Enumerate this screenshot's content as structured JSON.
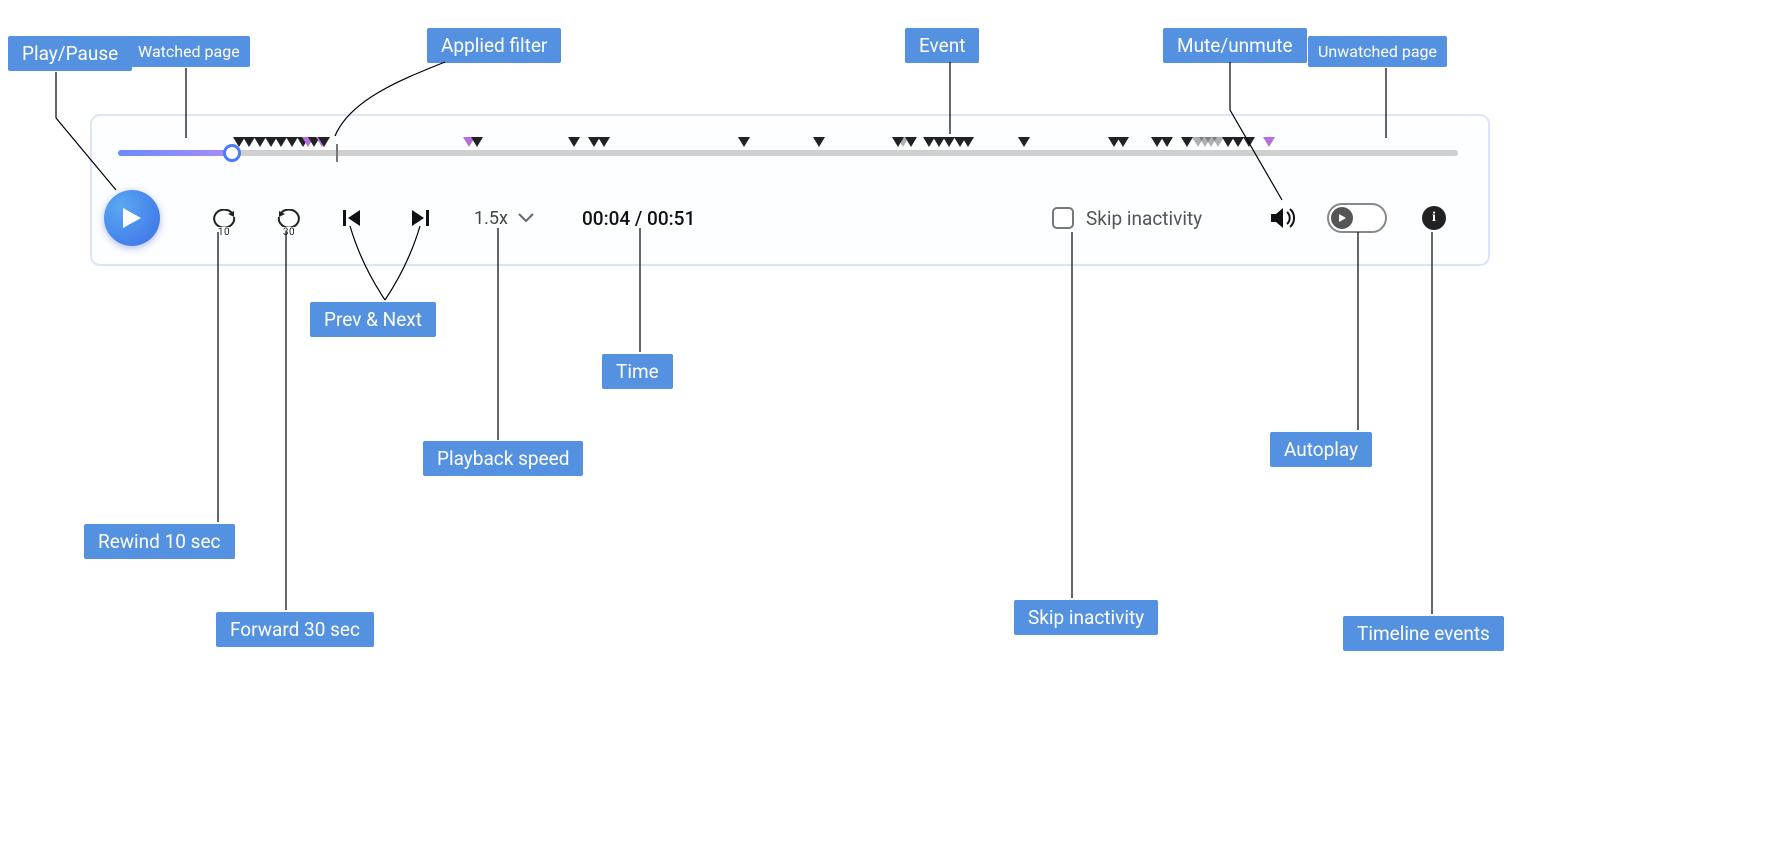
{
  "callouts": {
    "play_pause": "Play/Pause",
    "watched_page": "Watched page",
    "applied_filter": "Applied filter",
    "event": "Event",
    "mute_unmute": "Mute/unmute",
    "unwatched_page": "Unwatched page",
    "prev_next": "Prev & Next",
    "time": "Time",
    "playback_speed": "Playback speed",
    "rewind_10": "Rewind 10 sec",
    "forward_30": "Forward 30 sec",
    "skip_inactivity": "Skip inactivity",
    "autoplay": "Autoplay",
    "timeline_events": "Timeline events"
  },
  "player": {
    "rewind_amount": "10",
    "forward_amount": "30",
    "speed": "1.5x",
    "time": "00:04 / 00:51",
    "skip_label": "Skip inactivity",
    "progress_pct": 8.5,
    "filter_pct": 16.3
  },
  "markers": [
    {
      "p": 9.0,
      "t": "n"
    },
    {
      "p": 9.8,
      "t": "n"
    },
    {
      "p": 10.6,
      "t": "n"
    },
    {
      "p": 11.4,
      "t": "n"
    },
    {
      "p": 12.2,
      "t": "n"
    },
    {
      "p": 13.0,
      "t": "n"
    },
    {
      "p": 13.8,
      "t": "n"
    },
    {
      "p": 14.2,
      "t": "a"
    },
    {
      "p": 14.6,
      "t": "n"
    },
    {
      "p": 15.2,
      "t": "a"
    },
    {
      "p": 15.4,
      "t": "n"
    },
    {
      "p": 26.2,
      "t": "a"
    },
    {
      "p": 26.8,
      "t": "n"
    },
    {
      "p": 34.0,
      "t": "n"
    },
    {
      "p": 35.5,
      "t": "n"
    },
    {
      "p": 36.3,
      "t": "n"
    },
    {
      "p": 46.7,
      "t": "n"
    },
    {
      "p": 52.3,
      "t": "n"
    },
    {
      "p": 58.2,
      "t": "n"
    },
    {
      "p": 58.6,
      "t": "f"
    },
    {
      "p": 59.2,
      "t": "n"
    },
    {
      "p": 60.5,
      "t": "n"
    },
    {
      "p": 61.3,
      "t": "n"
    },
    {
      "p": 62.0,
      "t": "n"
    },
    {
      "p": 62.8,
      "t": "n"
    },
    {
      "p": 63.4,
      "t": "n"
    },
    {
      "p": 67.6,
      "t": "n"
    },
    {
      "p": 74.3,
      "t": "n"
    },
    {
      "p": 75.0,
      "t": "n"
    },
    {
      "p": 77.5,
      "t": "n"
    },
    {
      "p": 78.3,
      "t": "n"
    },
    {
      "p": 79.8,
      "t": "n"
    },
    {
      "p": 80.6,
      "t": "f"
    },
    {
      "p": 81.1,
      "t": "f"
    },
    {
      "p": 81.6,
      "t": "f"
    },
    {
      "p": 82.1,
      "t": "f"
    },
    {
      "p": 82.8,
      "t": "n"
    },
    {
      "p": 83.6,
      "t": "n"
    },
    {
      "p": 84.4,
      "t": "n"
    },
    {
      "p": 85.9,
      "t": "a"
    }
  ]
}
